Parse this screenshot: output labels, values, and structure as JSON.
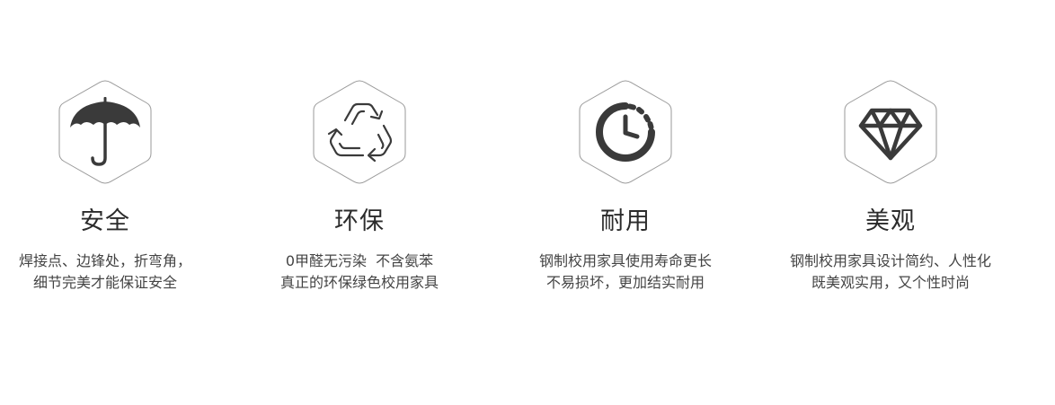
{
  "features": [
    {
      "icon": "umbrella-icon",
      "title": "安全",
      "line1": "焊接点、边锋处，折弯角，",
      "line2": "细节完美才能保证安全"
    },
    {
      "icon": "recycle-icon",
      "title": "环保",
      "line1": "0甲醛无污染  不含氨苯",
      "line2": "真正的环保绿色校用家具"
    },
    {
      "icon": "timer-icon",
      "title": "耐用",
      "line1": "钢制校用家具使用寿命更长",
      "line2": "不易损坏，更加结实耐用"
    },
    {
      "icon": "diamond-icon",
      "title": "美观",
      "line1": "钢制校用家具设计简约、人性化",
      "line2": "既美观实用，又个性时尚"
    }
  ],
  "colors": {
    "icon": "#3a3a3a",
    "hex_border": "#9a9a9a",
    "text": "#444444"
  }
}
